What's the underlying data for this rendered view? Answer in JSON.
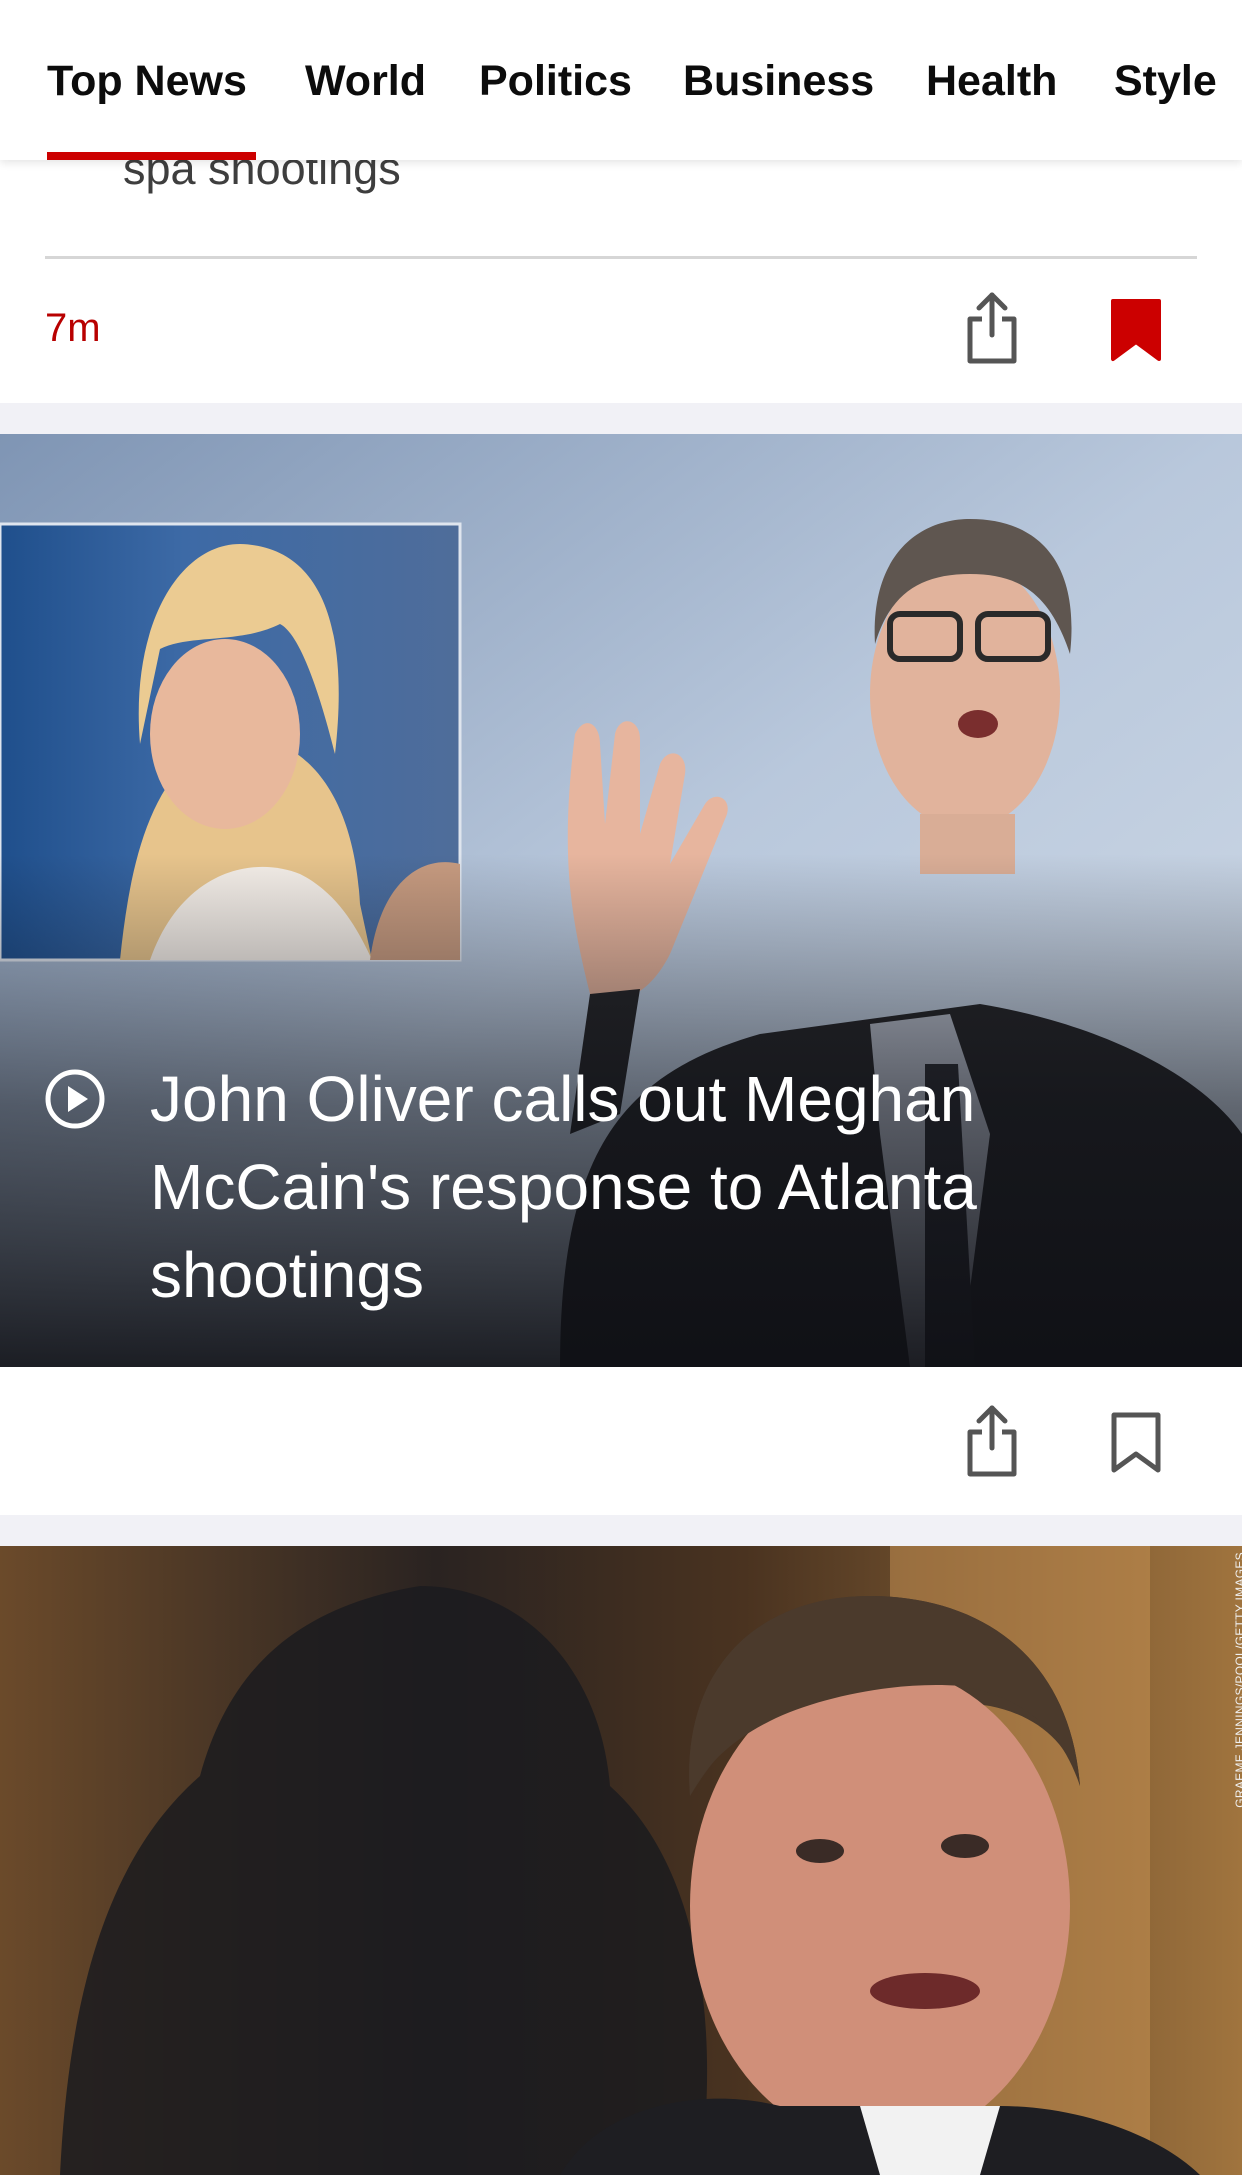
{
  "nav": {
    "tabs": [
      {
        "label": "Top News",
        "selected": true
      },
      {
        "label": "World",
        "selected": false
      },
      {
        "label": "Politics",
        "selected": false
      },
      {
        "label": "Business",
        "selected": false
      },
      {
        "label": "Health",
        "selected": false
      },
      {
        "label": "Style",
        "selected": false
      }
    ]
  },
  "feed": {
    "card1": {
      "title_fragment": "spa shootings",
      "timestamp": "7m",
      "share_icon": "share-icon",
      "bookmark_icon": "bookmark-filled-icon",
      "bookmarked": true
    },
    "card2": {
      "type": "video",
      "play_icon": "play-circle-icon",
      "headline": "John Oliver calls out Meghan McCain's response to Atlanta shootings",
      "share_icon": "share-icon",
      "bookmark_icon": "bookmark-outline-icon",
      "bookmarked": false
    },
    "card3": {
      "photo_credit": "GRAEME JENNINGS/POOL/GETTY IMAGES"
    }
  },
  "colors": {
    "accent_red": "#cc0000",
    "timestamp_red": "#b80000",
    "text_dark": "#0c0c0c",
    "icon_gray": "#555555",
    "feed_gap": "#f1f1f6"
  }
}
